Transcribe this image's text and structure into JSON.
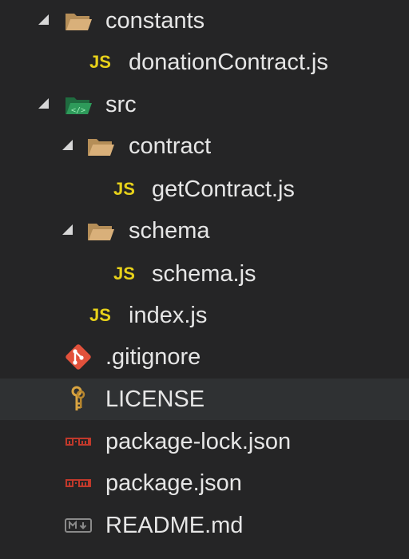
{
  "explorer": {
    "items": [
      {
        "label": "constants",
        "icon": "folder-open-icon",
        "expanded": true
      },
      {
        "label": "donationContract.js",
        "icon_text": "JS",
        "icon": "javascript-file-icon"
      },
      {
        "label": "src",
        "icon": "folder-src-open-icon",
        "expanded": true
      },
      {
        "label": "contract",
        "icon": "folder-open-icon",
        "expanded": true
      },
      {
        "label": "getContract.js",
        "icon_text": "JS",
        "icon": "javascript-file-icon"
      },
      {
        "label": "schema",
        "icon": "folder-open-icon",
        "expanded": true
      },
      {
        "label": "schema.js",
        "icon_text": "JS",
        "icon": "javascript-file-icon"
      },
      {
        "label": "index.js",
        "icon_text": "JS",
        "icon": "javascript-file-icon"
      },
      {
        "label": ".gitignore",
        "icon": "git-icon"
      },
      {
        "label": "LICENSE",
        "icon": "license-key-icon",
        "selected": true
      },
      {
        "label": "package-lock.json",
        "icon": "npm-icon"
      },
      {
        "label": "package.json",
        "icon": "npm-icon"
      },
      {
        "label": "README.md",
        "icon": "markdown-icon"
      }
    ]
  },
  "colors": {
    "background": "#252526",
    "selected_row": "#2f3133",
    "text": "#e6e6e6",
    "js": "#e8d21a",
    "folder": "#c9a26b",
    "src_folder": "#2e8b57",
    "git": "#e2513b",
    "npm": "#c0392b",
    "license": "#d9a441",
    "markdown": "#8a8a8a"
  }
}
